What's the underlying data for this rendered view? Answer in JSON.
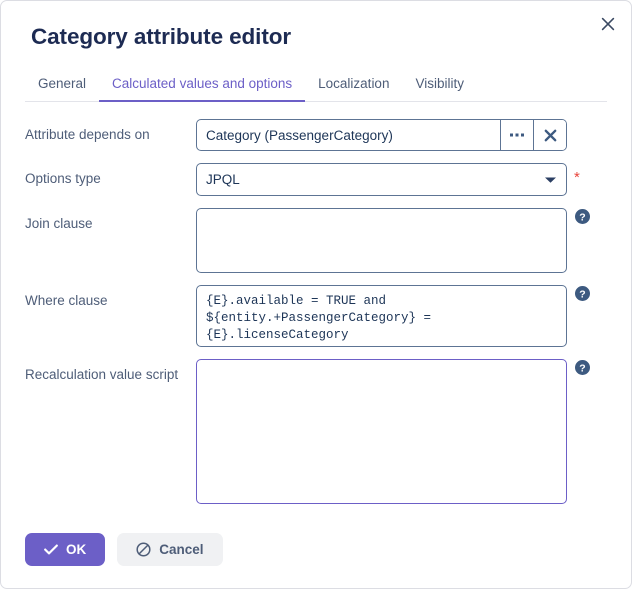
{
  "dialog": {
    "title": "Category attribute editor",
    "close_icon": "close-icon"
  },
  "tabs": [
    {
      "label": "General",
      "active": false
    },
    {
      "label": "Calculated values and options",
      "active": true
    },
    {
      "label": "Localization",
      "active": false
    },
    {
      "label": "Visibility",
      "active": false
    }
  ],
  "fields": {
    "attribute_depends_on": {
      "label": "Attribute depends on",
      "value": "Category (PassengerCategory)",
      "placeholder": "",
      "ellipsis_icon": "ellipsis-icon",
      "clear_icon": "clear-icon"
    },
    "options_type": {
      "label": "Options type",
      "value": "JPQL",
      "required_marker": "*",
      "arrow_icon": "chevron-down-icon"
    },
    "join_clause": {
      "label": "Join clause",
      "value": "",
      "help_icon": "help-icon"
    },
    "where_clause": {
      "label": "Where clause",
      "value": "{E}.available = TRUE and\n${entity.+PassengerCategory} =\n{E}.licenseCategory",
      "help_icon": "help-icon"
    },
    "recalculation_value_script": {
      "label": "Recalculation value script",
      "value": "",
      "help_icon": "help-icon"
    }
  },
  "footer": {
    "ok_label": "OK",
    "ok_icon": "check-icon",
    "cancel_label": "Cancel",
    "cancel_icon": "prohibited-icon"
  },
  "colors": {
    "accent": "#6c5fc7",
    "title": "#1d2b53",
    "label": "#4e5d78",
    "field_border": "#5d7494",
    "required": "#e8453c",
    "help_badge": "#3d5a80"
  }
}
